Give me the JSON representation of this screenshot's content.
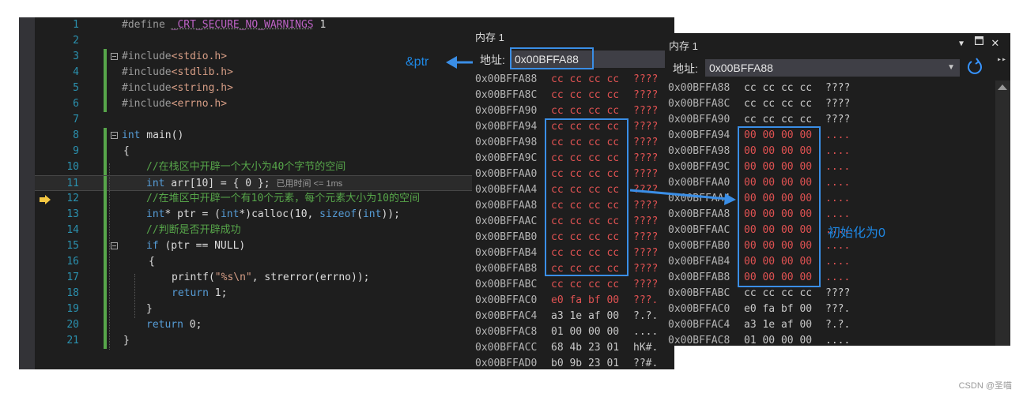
{
  "editor": {
    "lines": [
      {
        "num": "1"
      },
      {
        "num": "2"
      },
      {
        "num": "3"
      },
      {
        "num": "4"
      },
      {
        "num": "5"
      },
      {
        "num": "6"
      },
      {
        "num": "7"
      },
      {
        "num": "8"
      },
      {
        "num": "9"
      },
      {
        "num": "10"
      },
      {
        "num": "11"
      },
      {
        "num": "12"
      },
      {
        "num": "13"
      },
      {
        "num": "14"
      },
      {
        "num": "15"
      },
      {
        "num": "16"
      },
      {
        "num": "17"
      },
      {
        "num": "18"
      },
      {
        "num": "19"
      },
      {
        "num": "20"
      },
      {
        "num": "21"
      }
    ],
    "code": {
      "l1_pp": "#define ",
      "l1_macro": "_CRT_SECURE_NO_WARNINGS",
      "l1_val": " 1",
      "l3_pp": "#include",
      "l3_hdr": "<stdio.h>",
      "l4_pp": "#include",
      "l4_hdr": "<stdlib.h>",
      "l5_pp": "#include",
      "l5_hdr": "<string.h>",
      "l6_pp": "#include",
      "l6_hdr": "<errno.h>",
      "l8_kw": "int",
      "l8_rest": " main()",
      "l9": "{",
      "l10_comment": "//在栈区中开辟一个大小为40个字节的空间",
      "l11_kw": "int",
      "l11_rest": " arr[10] = { 0 };",
      "l11_perf": "已用时间 <= 1ms",
      "l12_comment": "//在堆区中开辟一个有10个元素，每个元素大小为10的空间",
      "l13_kw1": "int",
      "l13_a": "* ptr = (",
      "l13_kw2": "int",
      "l13_b": "*)calloc(10, ",
      "l13_kw3": "sizeof",
      "l13_c": "(",
      "l13_kw4": "int",
      "l13_d": "));",
      "l14_comment": "//判断是否开辟成功",
      "l15_kw": "if",
      "l15_rest": " (ptr == NULL)",
      "l16": "{",
      "l17_a": "printf(",
      "l17_str": "\"%s\\n\"",
      "l17_b": ", strerror(errno));",
      "l18_kw": "return",
      "l18_rest": " 1;",
      "l19": "}",
      "l20_kw": "return",
      "l20_rest": " 0;",
      "l21": "}"
    }
  },
  "mem1": {
    "title": "内存 1",
    "address_label": "地址:",
    "address_value": "0x00BFFA88",
    "rows": [
      {
        "addr": "0x00BFFA88",
        "bytes": "cc cc cc cc",
        "chars": "????"
      },
      {
        "addr": "0x00BFFA8C",
        "bytes": "cc cc cc cc",
        "chars": "????"
      },
      {
        "addr": "0x00BFFA90",
        "bytes": "cc cc cc cc",
        "chars": "????"
      },
      {
        "addr": "0x00BFFA94",
        "bytes": "cc cc cc cc",
        "chars": "????"
      },
      {
        "addr": "0x00BFFA98",
        "bytes": "cc cc cc cc",
        "chars": "????"
      },
      {
        "addr": "0x00BFFA9C",
        "bytes": "cc cc cc cc",
        "chars": "????"
      },
      {
        "addr": "0x00BFFAA0",
        "bytes": "cc cc cc cc",
        "chars": "????"
      },
      {
        "addr": "0x00BFFAA4",
        "bytes": "cc cc cc cc",
        "chars": "????"
      },
      {
        "addr": "0x00BFFAA8",
        "bytes": "cc cc cc cc",
        "chars": "????"
      },
      {
        "addr": "0x00BFFAAC",
        "bytes": "cc cc cc cc",
        "chars": "????"
      },
      {
        "addr": "0x00BFFAB0",
        "bytes": "cc cc cc cc",
        "chars": "????"
      },
      {
        "addr": "0x00BFFAB4",
        "bytes": "cc cc cc cc",
        "chars": "????"
      },
      {
        "addr": "0x00BFFAB8",
        "bytes": "cc cc cc cc",
        "chars": "????"
      },
      {
        "addr": "0x00BFFABC",
        "bytes": "cc cc cc cc",
        "chars": "????"
      },
      {
        "addr": "0x00BFFAC0",
        "bytes": "e0 fa bf 00",
        "chars": "???."
      },
      {
        "addr": "0x00BFFAC4",
        "bytes": "a3 1e af 00",
        "chars": "?.?."
      },
      {
        "addr": "0x00BFFAC8",
        "bytes": "01 00 00 00",
        "chars": "...."
      },
      {
        "addr": "0x00BFFACC",
        "bytes": "68 4b 23 01",
        "chars": "hK#."
      },
      {
        "addr": "0x00BFFAD0",
        "bytes": "b0 9b 23 01",
        "chars": "??#."
      }
    ]
  },
  "mem2": {
    "title": "内存 1",
    "address_label": "地址:",
    "address_value": "0x00BFFA88",
    "rows": [
      {
        "addr": "0x00BFFA88",
        "bytes": "cc cc cc cc",
        "chars": "????"
      },
      {
        "addr": "0x00BFFA8C",
        "bytes": "cc cc cc cc",
        "chars": "????"
      },
      {
        "addr": "0x00BFFA90",
        "bytes": "cc cc cc cc",
        "chars": "????"
      },
      {
        "addr": "0x00BFFA94",
        "bytes": "00 00 00 00",
        "chars": "...."
      },
      {
        "addr": "0x00BFFA98",
        "bytes": "00 00 00 00",
        "chars": "...."
      },
      {
        "addr": "0x00BFFA9C",
        "bytes": "00 00 00 00",
        "chars": "...."
      },
      {
        "addr": "0x00BFFAA0",
        "bytes": "00 00 00 00",
        "chars": "...."
      },
      {
        "addr": "0x00BFFAA4",
        "bytes": "00 00 00 00",
        "chars": "...."
      },
      {
        "addr": "0x00BFFAA8",
        "bytes": "00 00 00 00",
        "chars": "...."
      },
      {
        "addr": "0x00BFFAAC",
        "bytes": "00 00 00 00",
        "chars": "...."
      },
      {
        "addr": "0x00BFFAB0",
        "bytes": "00 00 00 00",
        "chars": "...."
      },
      {
        "addr": "0x00BFFAB4",
        "bytes": "00 00 00 00",
        "chars": "...."
      },
      {
        "addr": "0x00BFFAB8",
        "bytes": "00 00 00 00",
        "chars": "...."
      },
      {
        "addr": "0x00BFFABC",
        "bytes": "cc cc cc cc",
        "chars": "????"
      },
      {
        "addr": "0x00BFFAC0",
        "bytes": "e0 fa bf 00",
        "chars": "???."
      },
      {
        "addr": "0x00BFFAC4",
        "bytes": "a3 1e af 00",
        "chars": "?.?."
      },
      {
        "addr": "0x00BFFAC8",
        "bytes": "01 00 00 00",
        "chars": "...."
      }
    ]
  },
  "annotations": {
    "ptr_label": "&ptr",
    "init_label": "初始化为0"
  },
  "watermark": "CSDN @圣喵",
  "colors": {
    "editor_bg": "#1e1e1e",
    "annotation_blue": "#1e88e5",
    "changed_bytes": "#e05252",
    "comment_green": "#57a64a"
  }
}
